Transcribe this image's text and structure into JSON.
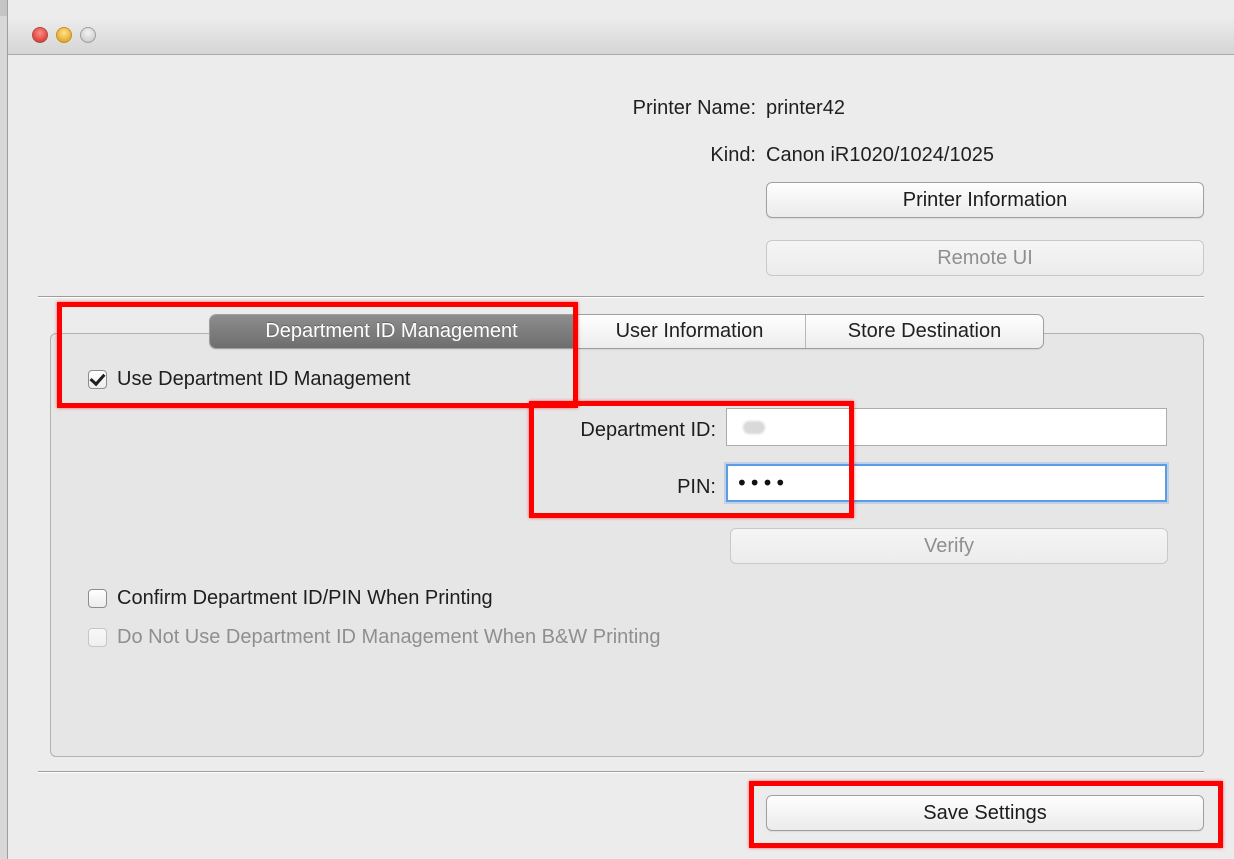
{
  "window": {
    "controls": {
      "close_icon": "close-window-icon",
      "minimize_icon": "minimize-window-icon",
      "zoom_icon": "zoom-window-icon"
    }
  },
  "printer": {
    "name_label": "Printer Name:",
    "name_value": "printer42",
    "kind_label": "Kind:",
    "kind_value": "Canon iR1020/1024/1025",
    "printer_information_button": "Printer Information",
    "remote_ui_button": "Remote UI"
  },
  "tabs": [
    {
      "label": "Department ID Management",
      "active": true
    },
    {
      "label": "User Information",
      "active": false
    },
    {
      "label": "Store Destination",
      "active": false
    }
  ],
  "department_id_management": {
    "use_department_id_management": {
      "label": "Use Department ID Management",
      "checked": true
    },
    "department_id": {
      "label": "Department ID:",
      "value": ""
    },
    "pin": {
      "label": "PIN:",
      "value": "••••"
    },
    "verify_button": "Verify",
    "confirm_when_printing": {
      "label": "Confirm Department ID/PIN When Printing",
      "checked": false
    },
    "bw_printing_option": {
      "label": "Do Not Use Department ID Management When B&W Printing",
      "checked": false,
      "disabled": true
    }
  },
  "footer": {
    "save_settings_button": "Save Settings"
  },
  "colors": {
    "annotation_red": "#ff0000",
    "focus_blue": "#5c9be6",
    "active_tab_gray": "#7b7b7b"
  }
}
